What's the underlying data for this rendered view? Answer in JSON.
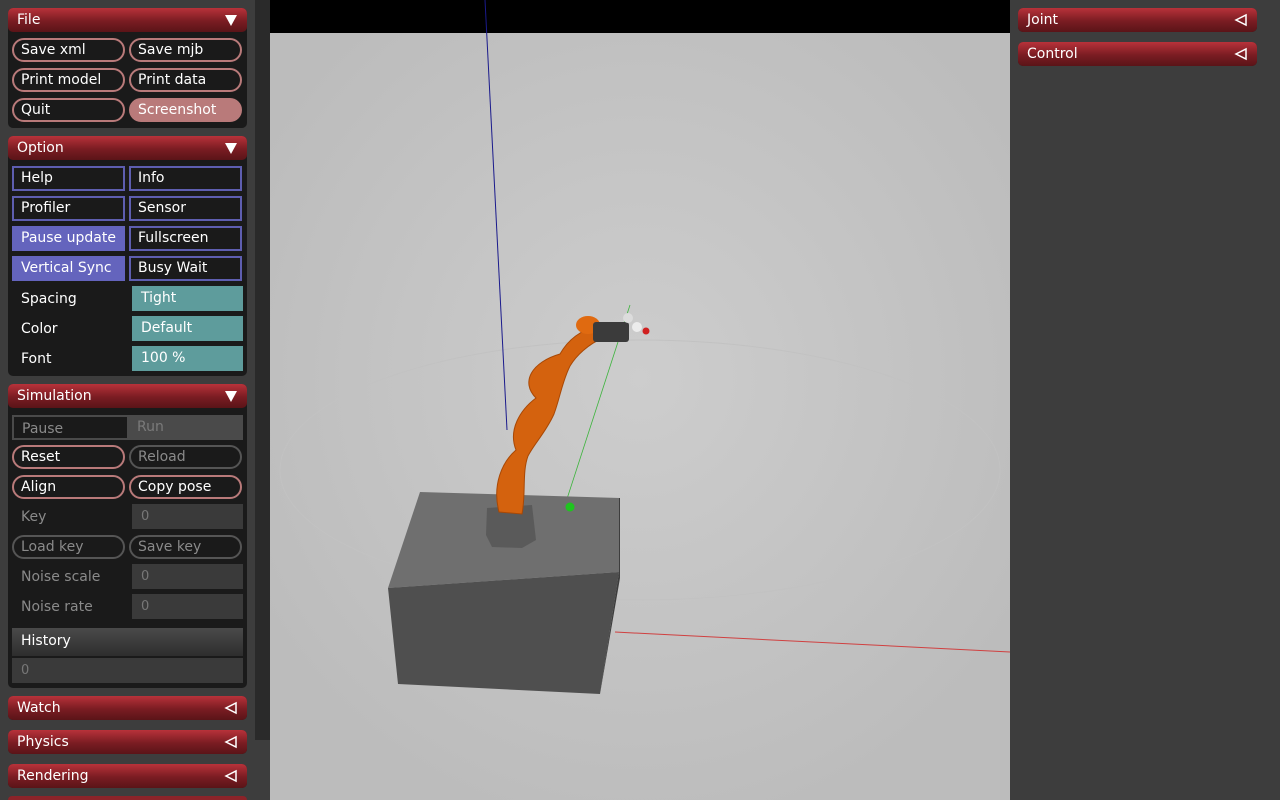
{
  "file": {
    "title": "File",
    "buttons": [
      "Save xml",
      "Save mjb",
      "Print model",
      "Print data",
      "Quit",
      "Screenshot"
    ]
  },
  "option": {
    "title": "Option",
    "checks": [
      {
        "label": "Help",
        "on": false
      },
      {
        "label": "Info",
        "on": false
      },
      {
        "label": "Profiler",
        "on": false
      },
      {
        "label": "Sensor",
        "on": false
      },
      {
        "label": "Pause update",
        "on": true
      },
      {
        "label": "Fullscreen",
        "on": false
      },
      {
        "label": "Vertical Sync",
        "on": true
      },
      {
        "label": "Busy Wait",
        "on": false
      }
    ],
    "spacing_label": "Spacing",
    "spacing_value": "Tight",
    "color_label": "Color",
    "color_value": "Default",
    "font_label": "Font",
    "font_value": "100 %"
  },
  "simulation": {
    "title": "Simulation",
    "pause": "Pause",
    "run": "Run",
    "reset": "Reset",
    "reload": "Reload",
    "align": "Align",
    "copy_pose": "Copy pose",
    "key_label": "Key",
    "key_value": "0",
    "load_key": "Load key",
    "save_key": "Save key",
    "noise_scale_label": "Noise scale",
    "noise_scale_value": "0",
    "noise_rate_label": "Noise rate",
    "noise_rate_value": "0",
    "history_label": "History",
    "history_value": "0"
  },
  "collapsed_left": [
    "Watch",
    "Physics",
    "Rendering"
  ],
  "collapsed_right": [
    "Joint",
    "Control"
  ],
  "colors": {
    "accent_red": "#8b2329",
    "check_on": "#6464bd",
    "select_teal": "#5e9c9c",
    "button_border": "#b97a7a"
  }
}
